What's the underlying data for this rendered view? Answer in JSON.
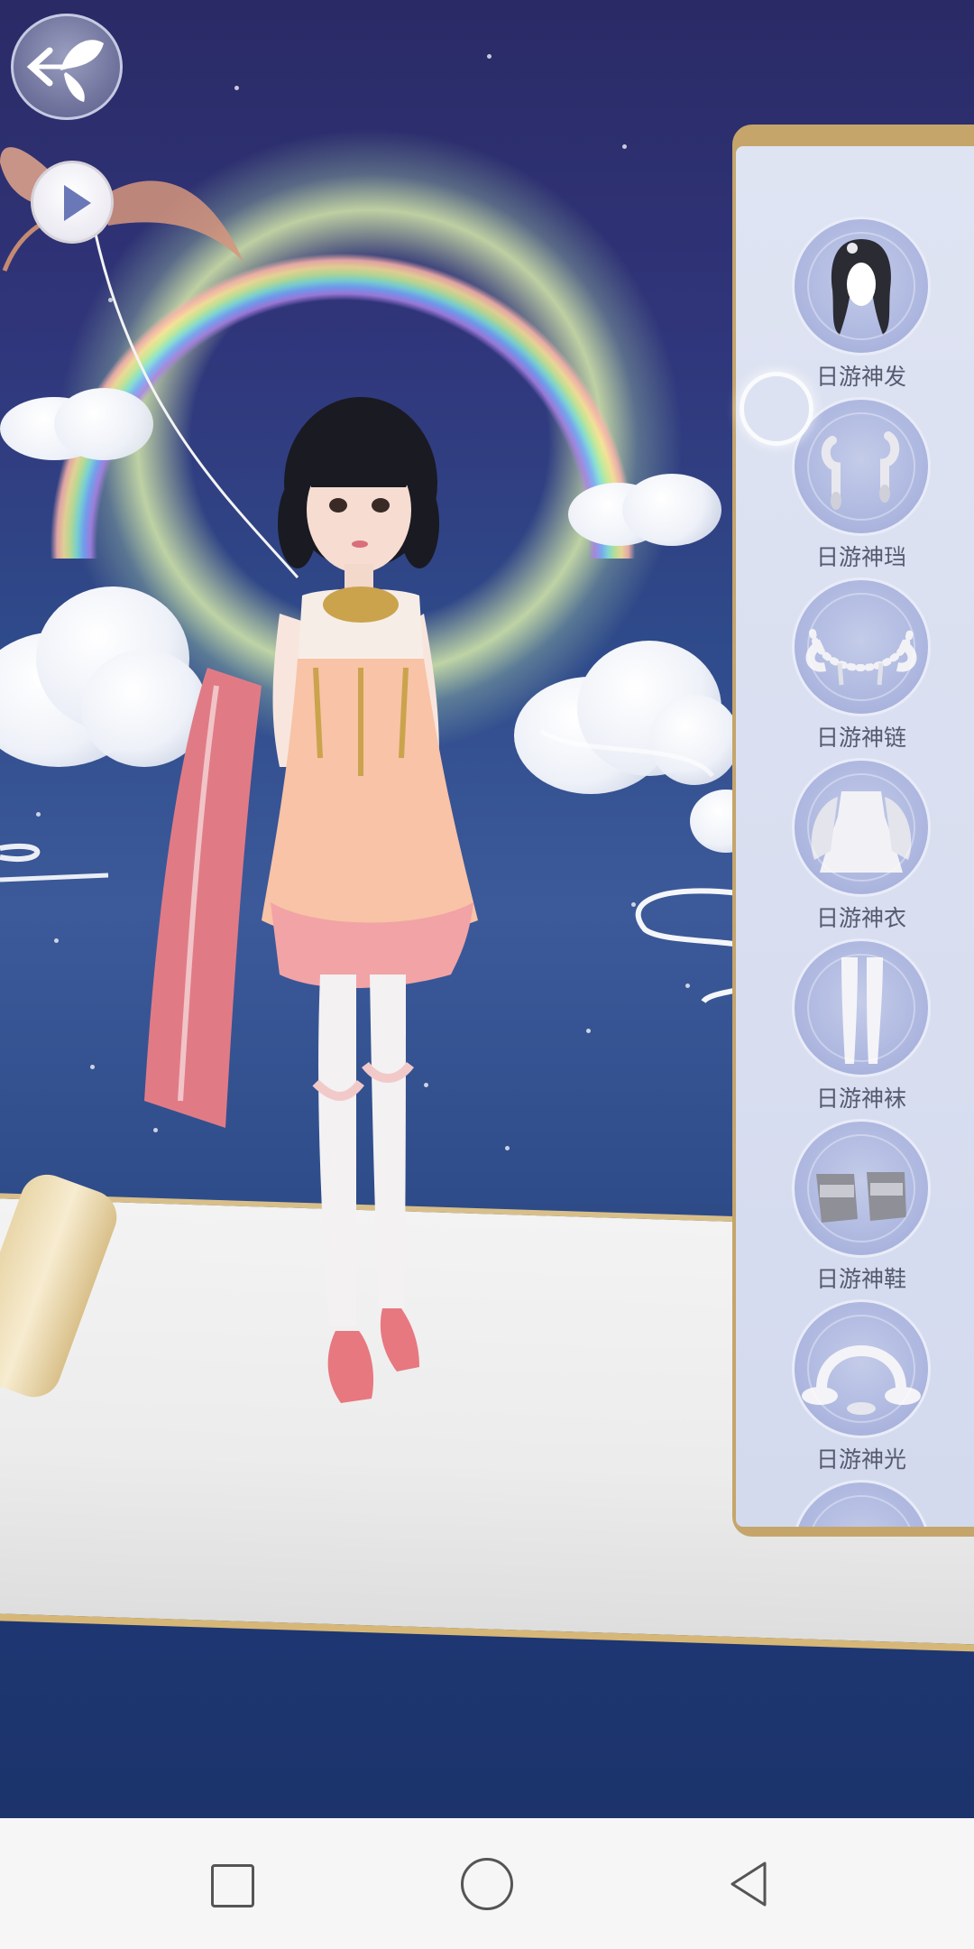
{
  "items": [
    {
      "label": "日游神发",
      "icon": "hair-icon"
    },
    {
      "label": "日游神珰",
      "icon": "earrings-icon"
    },
    {
      "label": "日游神链",
      "icon": "necklace-icon"
    },
    {
      "label": "日游神衣",
      "icon": "dress-icon"
    },
    {
      "label": "日游神袜",
      "icon": "stockings-icon"
    },
    {
      "label": "日游神鞋",
      "icon": "shoes-icon"
    },
    {
      "label": "日游神光",
      "icon": "halo-effect-icon"
    }
  ],
  "colors": {
    "panel_bg": "#d8ddf0",
    "panel_rim": "#c5a56a",
    "icon_bg": "#aeb8e0",
    "label_text": "#555a70",
    "sky_top": "#2a2a66",
    "sky_bottom": "#1c336b"
  }
}
